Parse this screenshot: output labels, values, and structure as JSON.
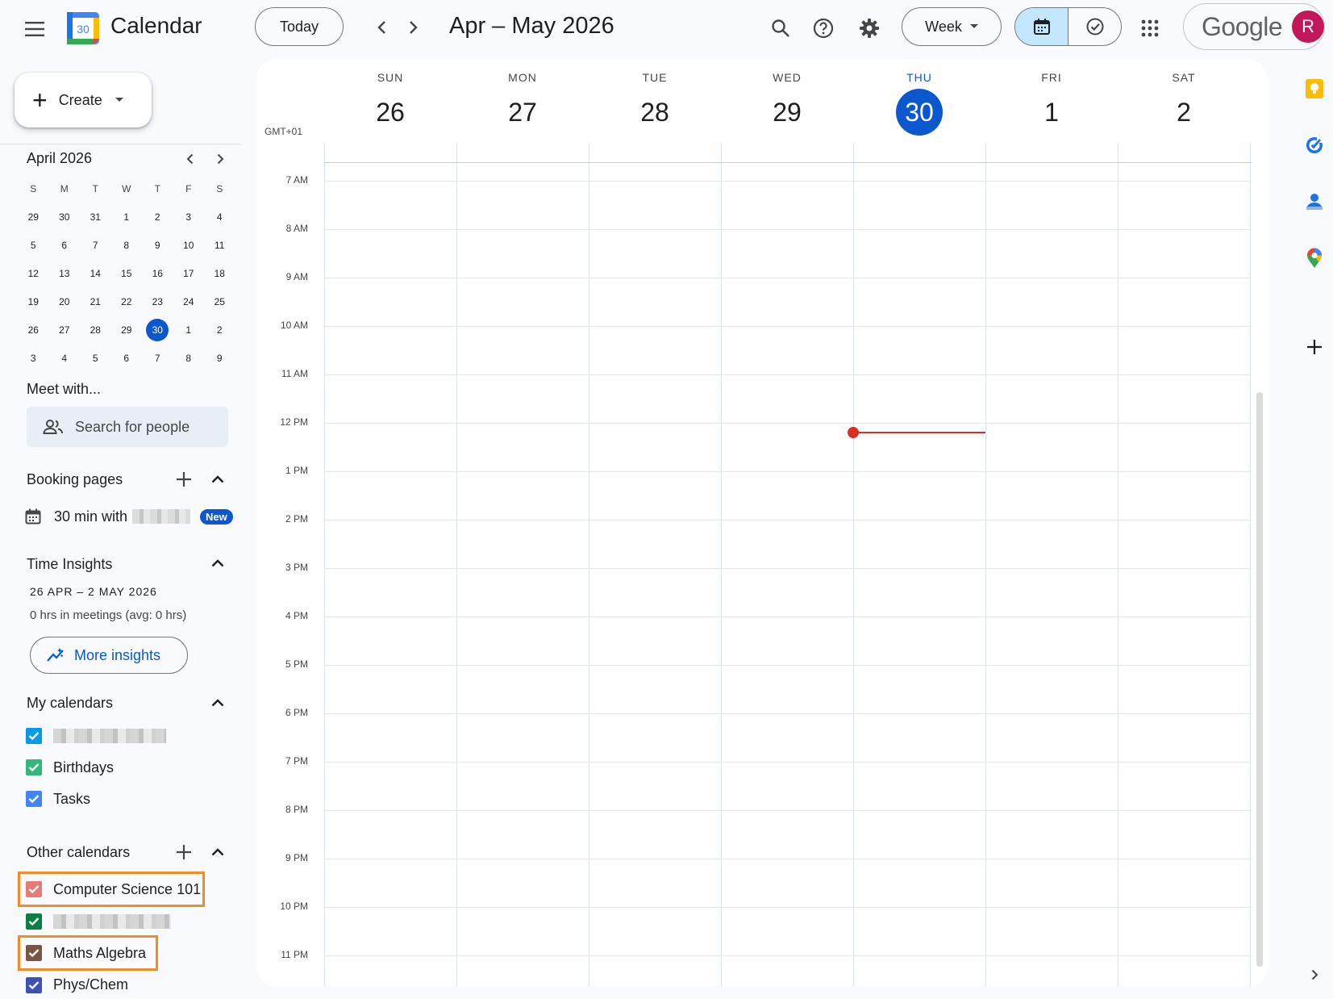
{
  "header": {
    "app_title": "Calendar",
    "logo_day": "30",
    "today_label": "Today",
    "range_title": "Apr – May 2026",
    "view_label": "Week",
    "google_word": "Google",
    "avatar_letter": "R"
  },
  "sidebar": {
    "create_label": "Create",
    "mini_calendar": {
      "title": "April 2026",
      "weekdays": [
        "S",
        "M",
        "T",
        "W",
        "T",
        "F",
        "S"
      ],
      "weeks": [
        [
          "29",
          "30",
          "31",
          "1",
          "2",
          "3",
          "4"
        ],
        [
          "5",
          "6",
          "7",
          "8",
          "9",
          "10",
          "11"
        ],
        [
          "12",
          "13",
          "14",
          "15",
          "16",
          "17",
          "18"
        ],
        [
          "19",
          "20",
          "21",
          "22",
          "23",
          "24",
          "25"
        ],
        [
          "26",
          "27",
          "28",
          "29",
          "30",
          "1",
          "2"
        ],
        [
          "3",
          "4",
          "5",
          "6",
          "7",
          "8",
          "9"
        ]
      ],
      "selected": "30"
    },
    "meet_title": "Meet with...",
    "people_search_placeholder": "Search for people",
    "booking": {
      "title": "Booking pages",
      "item_label": "30 min with",
      "badge": "New"
    },
    "insights": {
      "title": "Time Insights",
      "range": "26 APR – 2 MAY 2026",
      "summary": "0 hrs in meetings (avg: 0 hrs)",
      "button": "More insights"
    },
    "my_calendars": {
      "title": "My calendars",
      "items": [
        {
          "label": "",
          "color": "#039be5",
          "redacted": true
        },
        {
          "label": "Birthdays",
          "color": "#33b679"
        },
        {
          "label": "Tasks",
          "color": "#4285f4"
        }
      ]
    },
    "other_calendars": {
      "title": "Other calendars",
      "items": [
        {
          "label": "Computer Science 101",
          "color": "#e67c73",
          "highlighted": true
        },
        {
          "label": "",
          "color": "#0b8043",
          "redacted": true
        },
        {
          "label": "Maths Algebra",
          "color": "#795548",
          "highlighted": true
        },
        {
          "label": "Phys/Chem",
          "color": "#3f51b5"
        }
      ]
    }
  },
  "week": {
    "timezone": "GMT+01",
    "days": [
      {
        "dow": "SUN",
        "num": "26"
      },
      {
        "dow": "MON",
        "num": "27"
      },
      {
        "dow": "TUE",
        "num": "28"
      },
      {
        "dow": "WED",
        "num": "29"
      },
      {
        "dow": "THU",
        "num": "30",
        "today": true
      },
      {
        "dow": "FRI",
        "num": "1"
      },
      {
        "dow": "SAT",
        "num": "2"
      }
    ],
    "hours": [
      "7 AM",
      "8 AM",
      "9 AM",
      "10 AM",
      "11 AM",
      "12 PM",
      "1 PM",
      "2 PM",
      "3 PM",
      "4 PM",
      "5 PM",
      "6 PM",
      "7 PM",
      "8 PM",
      "9 PM",
      "10 PM",
      "11 PM"
    ],
    "current_time_hours": 12.2,
    "current_day_index": 4
  },
  "colors": {
    "accent": "#0b57d0",
    "now_indicator": "#d93025",
    "highlight_box": "#f28c28"
  },
  "right_rail": [
    "keep-icon",
    "tasks-icon",
    "contacts-icon",
    "maps-icon",
    "add-icon",
    "expand-icon"
  ]
}
